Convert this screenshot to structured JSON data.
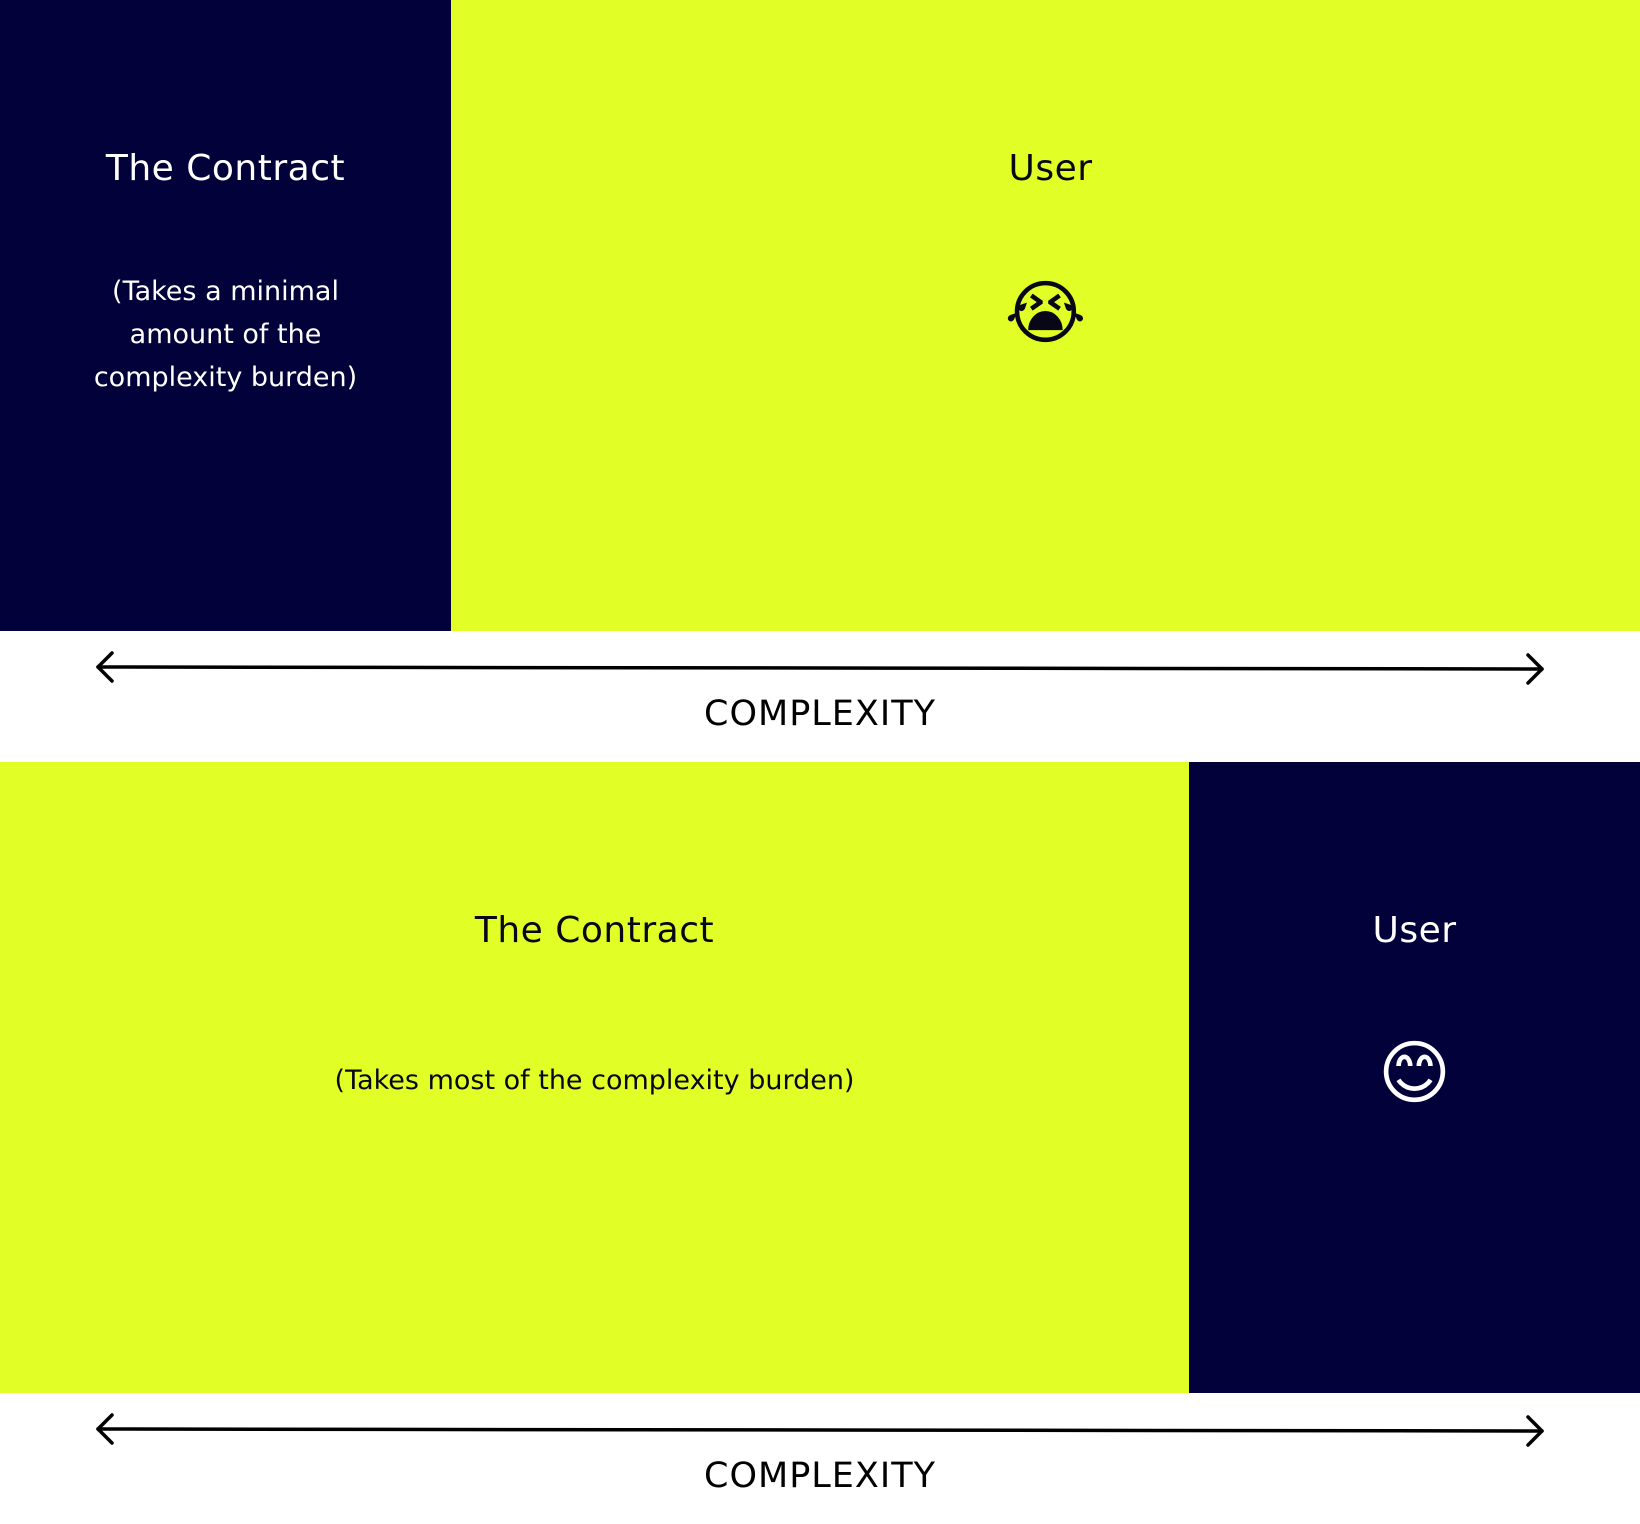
{
  "colors": {
    "dark": "#02013a",
    "lime": "#e1ff27",
    "axis": "#000000"
  },
  "diagram_top": {
    "contract": {
      "title": "The Contract",
      "subtitle": [
        "(Takes a minimal",
        "amount of the",
        "complexity burden)"
      ]
    },
    "user": {
      "title": "User",
      "emoji": "😭",
      "emoji_icon": "loudly-crying-face-icon"
    },
    "axis_label": "COMPLEXITY"
  },
  "diagram_bottom": {
    "contract": {
      "title": "The Contract",
      "subtitle": "(Takes most of the complexity burden)"
    },
    "user": {
      "title": "User",
      "emoji": "😊",
      "emoji_icon": "smiling-face-icon"
    },
    "axis_label": "COMPLEXITY"
  }
}
